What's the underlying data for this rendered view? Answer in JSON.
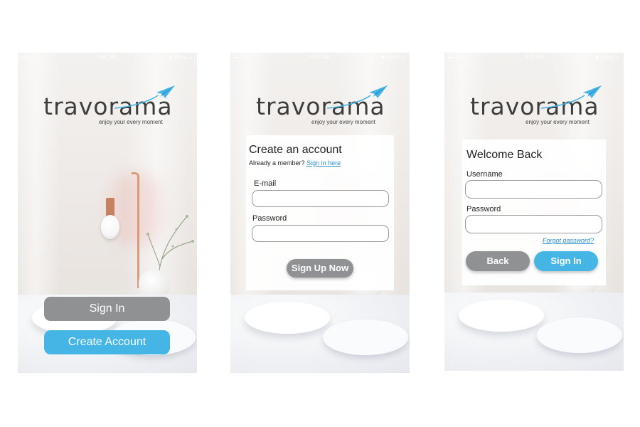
{
  "status_bar": {
    "signal": "▪▪▪ ◠",
    "time": "9:41 AM",
    "battery": "✱ 100% ▭"
  },
  "logo": {
    "wordmark": "travorama",
    "tagline": "enjoy your every moment"
  },
  "screen_welcome": {
    "sign_in_label": "Sign In",
    "create_account_label": "Create Account"
  },
  "screen_signup": {
    "title": "Create an account",
    "member_prompt": "Already a member?",
    "sign_in_link": "Sign in here",
    "email_label": "E-mail",
    "password_label": "Password",
    "email_value": "",
    "password_value": "",
    "submit_label": "Sign Up Now"
  },
  "screen_login": {
    "title": "Welcome Back",
    "username_label": "Username",
    "password_label": "Password",
    "username_value": "",
    "password_value": "",
    "forgot_label": "Forgot password?",
    "back_label": "Back",
    "sign_in_label": "Sign In"
  },
  "colors": {
    "accent": "#45b5e6",
    "button_gray": "#8f9193",
    "link": "#2a8fd1",
    "logo_text": "#3d3d3d"
  }
}
